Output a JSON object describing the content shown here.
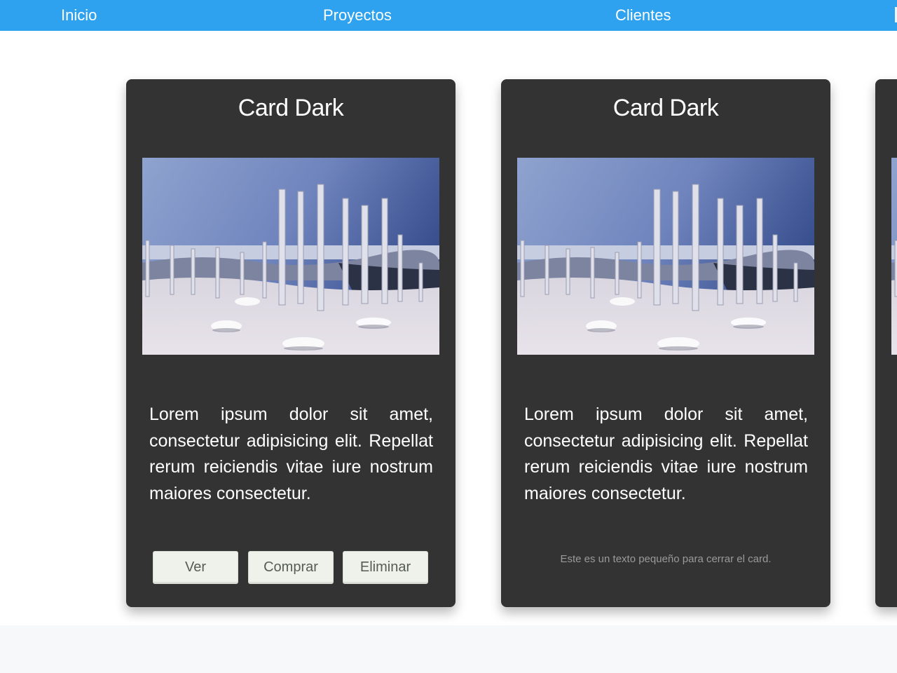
{
  "nav": {
    "items": [
      {
        "label": "Inicio"
      },
      {
        "label": "Proyectos"
      },
      {
        "label": "Clientes"
      }
    ]
  },
  "cards": [
    {
      "title": "Card Dark",
      "image_icon": "snowy-forest-image",
      "text": "Lorem ipsum dolor sit amet, consectetur adipisicing elit. Repellat rerum reiciendis vitae iure nostrum maiores consectetur.",
      "buttons": [
        {
          "label": "Ver"
        },
        {
          "label": "Comprar"
        },
        {
          "label": "Eliminar"
        }
      ]
    },
    {
      "title": "Card Dark",
      "image_icon": "snowy-forest-image",
      "text": "Lorem ipsum dolor sit amet, consectetur adipisicing elit. Repellat rerum reiciendis vitae iure nostrum maiores consectetur.",
      "footer_text": "Este es un texto pequeño para cerrar el card."
    }
  ],
  "colors": {
    "navbar": "#2ea2ee",
    "card_bg": "#333333",
    "button_bg": "#eef2ea"
  }
}
